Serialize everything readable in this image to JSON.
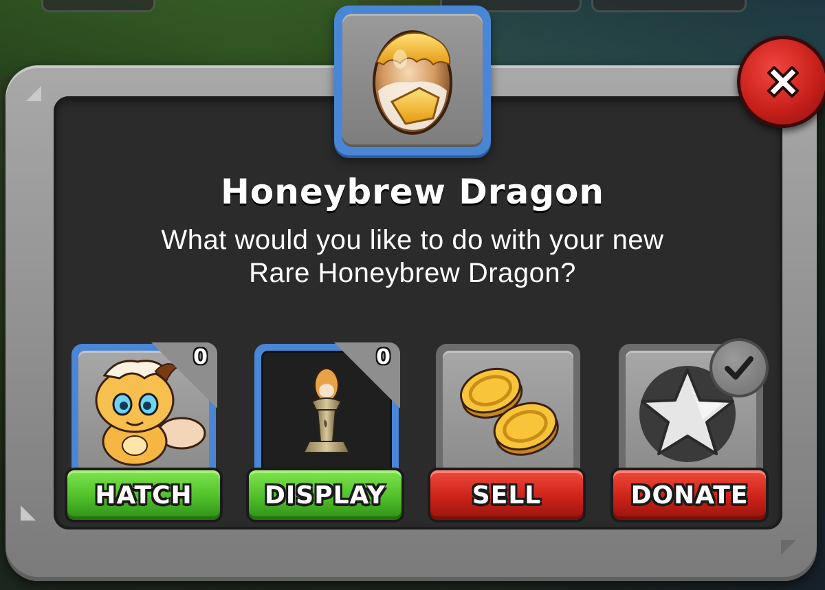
{
  "dialog": {
    "title": "Honeybrew Dragon",
    "subtitle_line1": "What would you like to do with your new",
    "subtitle_line2": "Rare Honeybrew Dragon?",
    "egg_icon": "honeybrew-egg-icon",
    "close_icon": "close-x-icon"
  },
  "actions": [
    {
      "label": "HATCH",
      "count": "0",
      "icon": "honeybrew-dragon-icon",
      "color": "#4fbf2a"
    },
    {
      "label": "DISPLAY",
      "count": "0",
      "icon": "egg-pedestal-icon",
      "color": "#4fbf2a"
    },
    {
      "label": "SELL",
      "icon": "gold-coins-icon",
      "color": "#cc2219"
    },
    {
      "label": "DONATE",
      "icon": "star-icon",
      "badge_icon": "checkmark-icon",
      "color": "#cc2219"
    }
  ],
  "colors": {
    "panel_gray": "#8d8d8d",
    "panel_inner": "#2b2b2b",
    "highlight_blue": "#4a86d6",
    "button_green": "#4fbf2a",
    "button_red": "#cc2219"
  }
}
